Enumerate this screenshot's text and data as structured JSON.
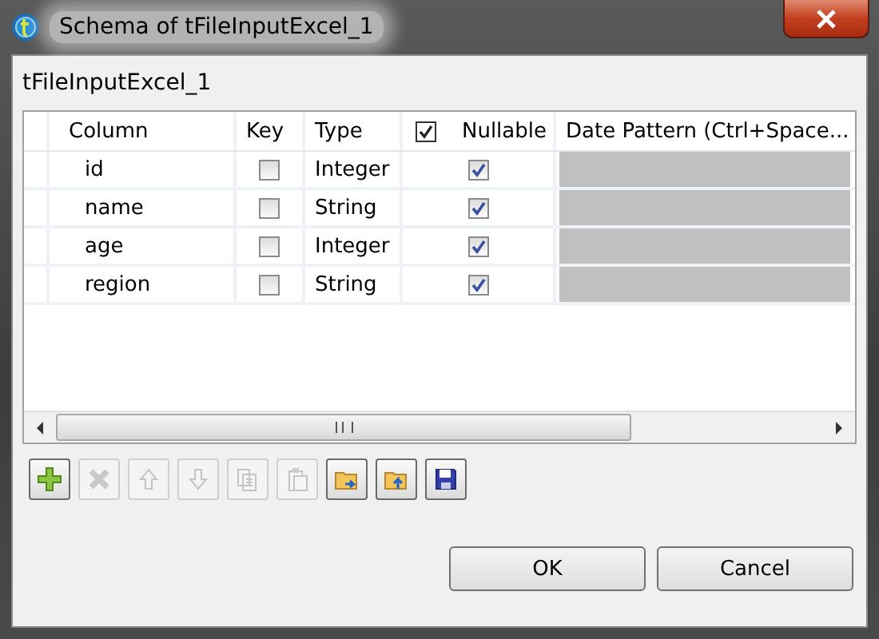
{
  "window": {
    "title": "Schema of tFileInputExcel_1"
  },
  "component_name": "tFileInputExcel_1",
  "table": {
    "columns": [
      {
        "label": "Column"
      },
      {
        "label": "Key"
      },
      {
        "label": "Type"
      },
      {
        "label": "Nullable",
        "header_checked": true
      },
      {
        "label": "Date Pattern (Ctrl+Space..."
      }
    ],
    "rows": [
      {
        "column": "id",
        "key": false,
        "type": "Integer",
        "nullable": true
      },
      {
        "column": "name",
        "key": false,
        "type": "String",
        "nullable": true
      },
      {
        "column": "age",
        "key": false,
        "type": "Integer",
        "nullable": true
      },
      {
        "column": "region",
        "key": false,
        "type": "String",
        "nullable": true
      }
    ]
  },
  "toolbar": [
    {
      "kind": "add",
      "disabled": false
    },
    {
      "kind": "remove",
      "disabled": true
    },
    {
      "kind": "up",
      "disabled": true
    },
    {
      "kind": "down",
      "disabled": true
    },
    {
      "kind": "copy",
      "disabled": true
    },
    {
      "kind": "paste",
      "disabled": true
    },
    {
      "kind": "import",
      "disabled": false
    },
    {
      "kind": "export",
      "disabled": false
    },
    {
      "kind": "save",
      "disabled": false
    }
  ],
  "buttons": [
    "OK",
    "Cancel"
  ]
}
